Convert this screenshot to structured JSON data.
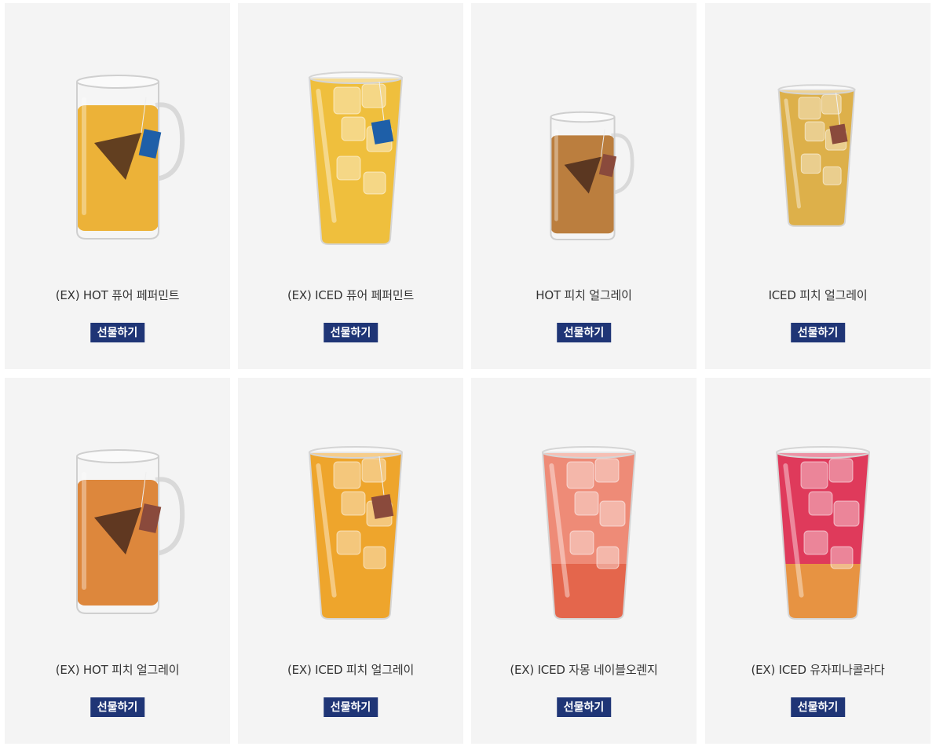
{
  "gift_label": "선물하기",
  "products": [
    {
      "name": "(EX) HOT 퓨어 페퍼민트",
      "kind": "hot",
      "liquid": "#e9a516",
      "tag": "#1e5fa8"
    },
    {
      "name": "(EX) ICED 퓨어 페퍼민트",
      "kind": "iced",
      "liquid": "#efbf3d",
      "tag": "#1e5fa8"
    },
    {
      "name": "HOT 피치 얼그레이",
      "kind": "hot-small",
      "liquid": "#b0681d",
      "tag": "#8a4a3c"
    },
    {
      "name": "ICED 피치 얼그레이",
      "kind": "iced-small",
      "liquid": "#ddb04a",
      "tag": "#8a4a3c"
    },
    {
      "name": "(EX) HOT 피치 얼그레이",
      "kind": "hot",
      "liquid": "#d8731a",
      "tag": "#8a4a3c"
    },
    {
      "name": "(EX) ICED 피치 얼그레이",
      "kind": "iced",
      "liquid": "#eea52c",
      "tag": "#8a4a3c"
    },
    {
      "name": "(EX) ICED 자몽 네이블오렌지",
      "kind": "iced-pink",
      "liquid": "#ee8b77",
      "tag": ""
    },
    {
      "name": "(EX) ICED 유자피나콜라다",
      "kind": "iced-red",
      "liquid": "#df3a5b",
      "tag": ""
    }
  ]
}
